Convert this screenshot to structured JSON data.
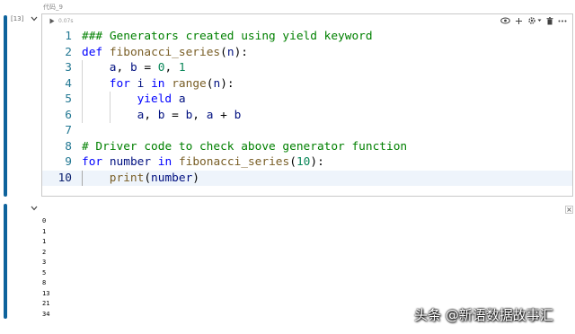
{
  "cell": {
    "label": "代码_9",
    "execution_count": "[13]",
    "exec_time": "0.07s",
    "code_lines": [
      {
        "num": "1",
        "indent": 0,
        "current": false,
        "tokens": [
          {
            "t": "### Generators created using yield keyword",
            "c": "comment"
          }
        ]
      },
      {
        "num": "2",
        "indent": 0,
        "current": false,
        "tokens": [
          {
            "t": "def",
            "c": "kw"
          },
          {
            "t": " ",
            "c": "plain"
          },
          {
            "t": "fibonacci_series",
            "c": "fn"
          },
          {
            "t": "(",
            "c": "plain"
          },
          {
            "t": "n",
            "c": "var"
          },
          {
            "t": "):",
            "c": "plain"
          }
        ]
      },
      {
        "num": "3",
        "indent": 1,
        "current": false,
        "tokens": [
          {
            "t": "a",
            "c": "var"
          },
          {
            "t": ", ",
            "c": "plain"
          },
          {
            "t": "b",
            "c": "var"
          },
          {
            "t": " = ",
            "c": "plain"
          },
          {
            "t": "0",
            "c": "num"
          },
          {
            "t": ", ",
            "c": "plain"
          },
          {
            "t": "1",
            "c": "num"
          }
        ]
      },
      {
        "num": "4",
        "indent": 1,
        "current": false,
        "tokens": [
          {
            "t": "for",
            "c": "kw"
          },
          {
            "t": " ",
            "c": "plain"
          },
          {
            "t": "i",
            "c": "var"
          },
          {
            "t": " ",
            "c": "plain"
          },
          {
            "t": "in",
            "c": "kw"
          },
          {
            "t": " ",
            "c": "plain"
          },
          {
            "t": "range",
            "c": "fn"
          },
          {
            "t": "(",
            "c": "plain"
          },
          {
            "t": "n",
            "c": "var"
          },
          {
            "t": "):",
            "c": "plain"
          }
        ]
      },
      {
        "num": "5",
        "indent": 2,
        "current": false,
        "tokens": [
          {
            "t": "yield",
            "c": "kw"
          },
          {
            "t": " ",
            "c": "plain"
          },
          {
            "t": "a",
            "c": "var"
          }
        ]
      },
      {
        "num": "6",
        "indent": 2,
        "current": false,
        "tokens": [
          {
            "t": "a",
            "c": "var"
          },
          {
            "t": ", ",
            "c": "plain"
          },
          {
            "t": "b",
            "c": "var"
          },
          {
            "t": " = ",
            "c": "plain"
          },
          {
            "t": "b",
            "c": "var"
          },
          {
            "t": ", ",
            "c": "plain"
          },
          {
            "t": "a",
            "c": "var"
          },
          {
            "t": " + ",
            "c": "plain"
          },
          {
            "t": "b",
            "c": "var"
          }
        ]
      },
      {
        "num": "7",
        "indent": 0,
        "current": false,
        "tokens": []
      },
      {
        "num": "8",
        "indent": 0,
        "current": false,
        "tokens": [
          {
            "t": "# Driver code to check above generator function",
            "c": "comment"
          }
        ]
      },
      {
        "num": "9",
        "indent": 0,
        "current": false,
        "tokens": [
          {
            "t": "for",
            "c": "kw"
          },
          {
            "t": " ",
            "c": "plain"
          },
          {
            "t": "number",
            "c": "var"
          },
          {
            "t": " ",
            "c": "plain"
          },
          {
            "t": "in",
            "c": "kw"
          },
          {
            "t": " ",
            "c": "plain"
          },
          {
            "t": "fibonacci_series",
            "c": "fn"
          },
          {
            "t": "(",
            "c": "plain"
          },
          {
            "t": "10",
            "c": "num"
          },
          {
            "t": "):",
            "c": "plain"
          }
        ]
      },
      {
        "num": "10",
        "indent": 1,
        "current": true,
        "tokens": [
          {
            "t": "print",
            "c": "fn"
          },
          {
            "t": "(",
            "c": "plain"
          },
          {
            "t": "number",
            "c": "var"
          },
          {
            "t": ")",
            "c": "plain"
          }
        ]
      }
    ]
  },
  "toolbar": {
    "icons": [
      "eye-icon",
      "plus-icon",
      "gear-icon",
      "chevron-down-icon",
      "trash-icon",
      "more-icon"
    ]
  },
  "output": {
    "lines": [
      "0",
      "1",
      "1",
      "2",
      "3",
      "5",
      "8",
      "13",
      "21",
      "34"
    ]
  },
  "watermark": "头条 @新语数据故事汇",
  "colors": {
    "accent_bar": "#0e639c",
    "keyword": "#0000ff",
    "comment": "#008000",
    "function": "#795e26",
    "number": "#098658",
    "variable": "#001080",
    "line_number": "#237893"
  }
}
